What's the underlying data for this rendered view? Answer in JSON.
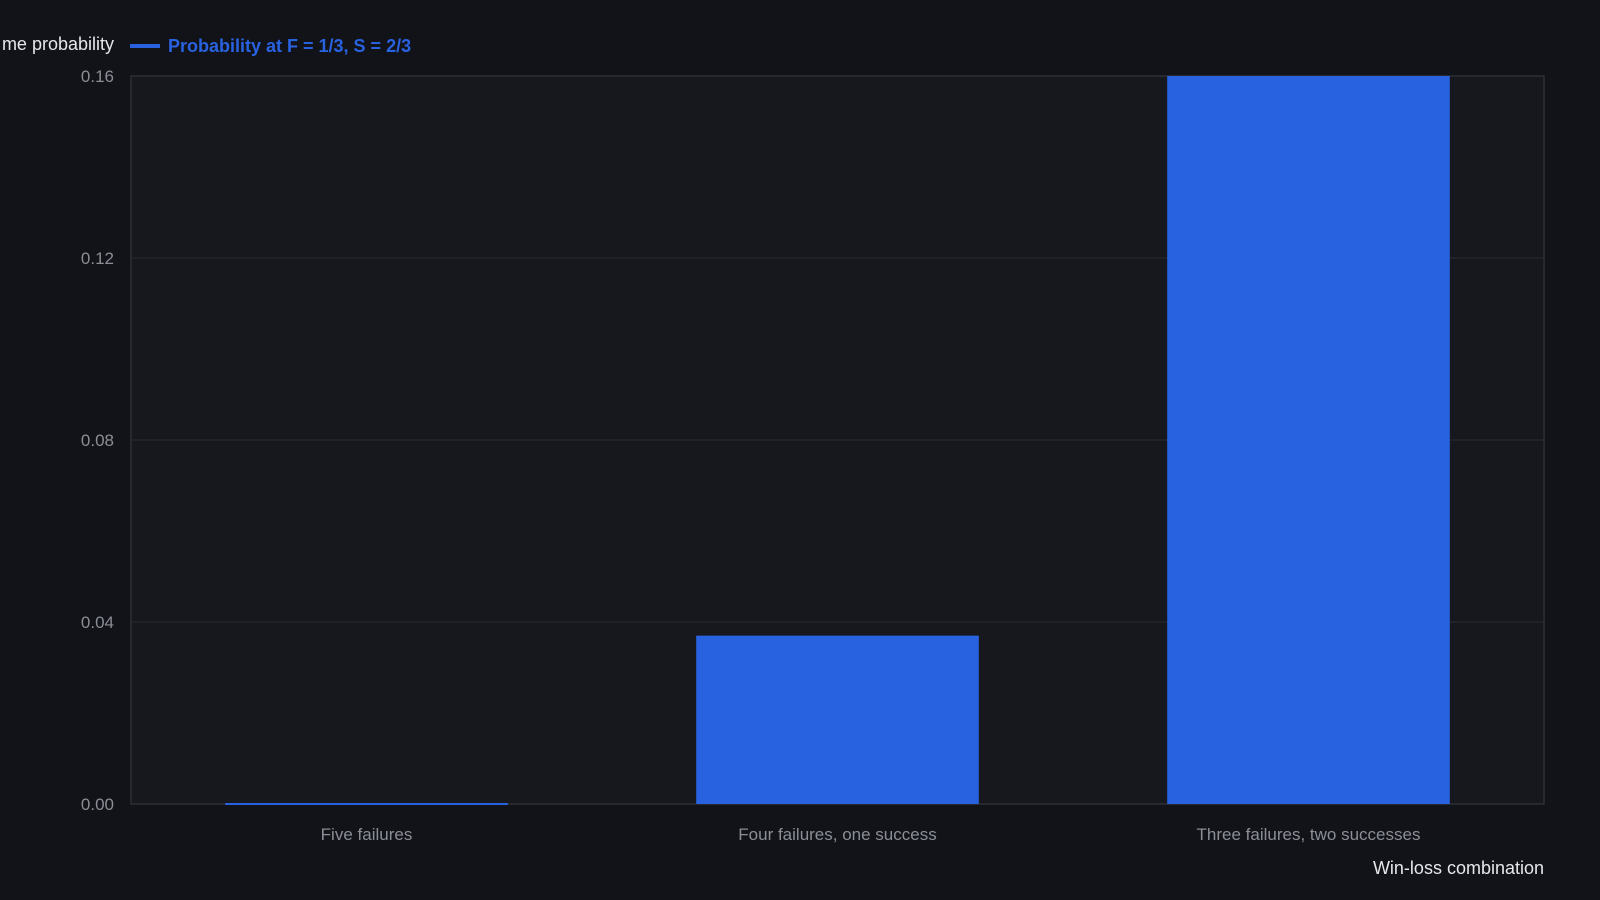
{
  "chart_data": {
    "type": "bar",
    "categories": [
      "Five failures",
      "Four failures, one success",
      "Three failures, two successes"
    ],
    "series": [
      {
        "name": "Probability at F = 1/3, S = 2/3",
        "values": [
          0.0004,
          0.037,
          0.16
        ],
        "color": "#2962e0"
      }
    ],
    "ylabel": "me probability",
    "xlabel": "Win-loss combination",
    "ylim": [
      0,
      0.16
    ],
    "yticks": [
      "0.00",
      "0.04",
      "0.08",
      "0.12",
      "0.16"
    ],
    "grid": true,
    "legend_position": "top-left"
  }
}
